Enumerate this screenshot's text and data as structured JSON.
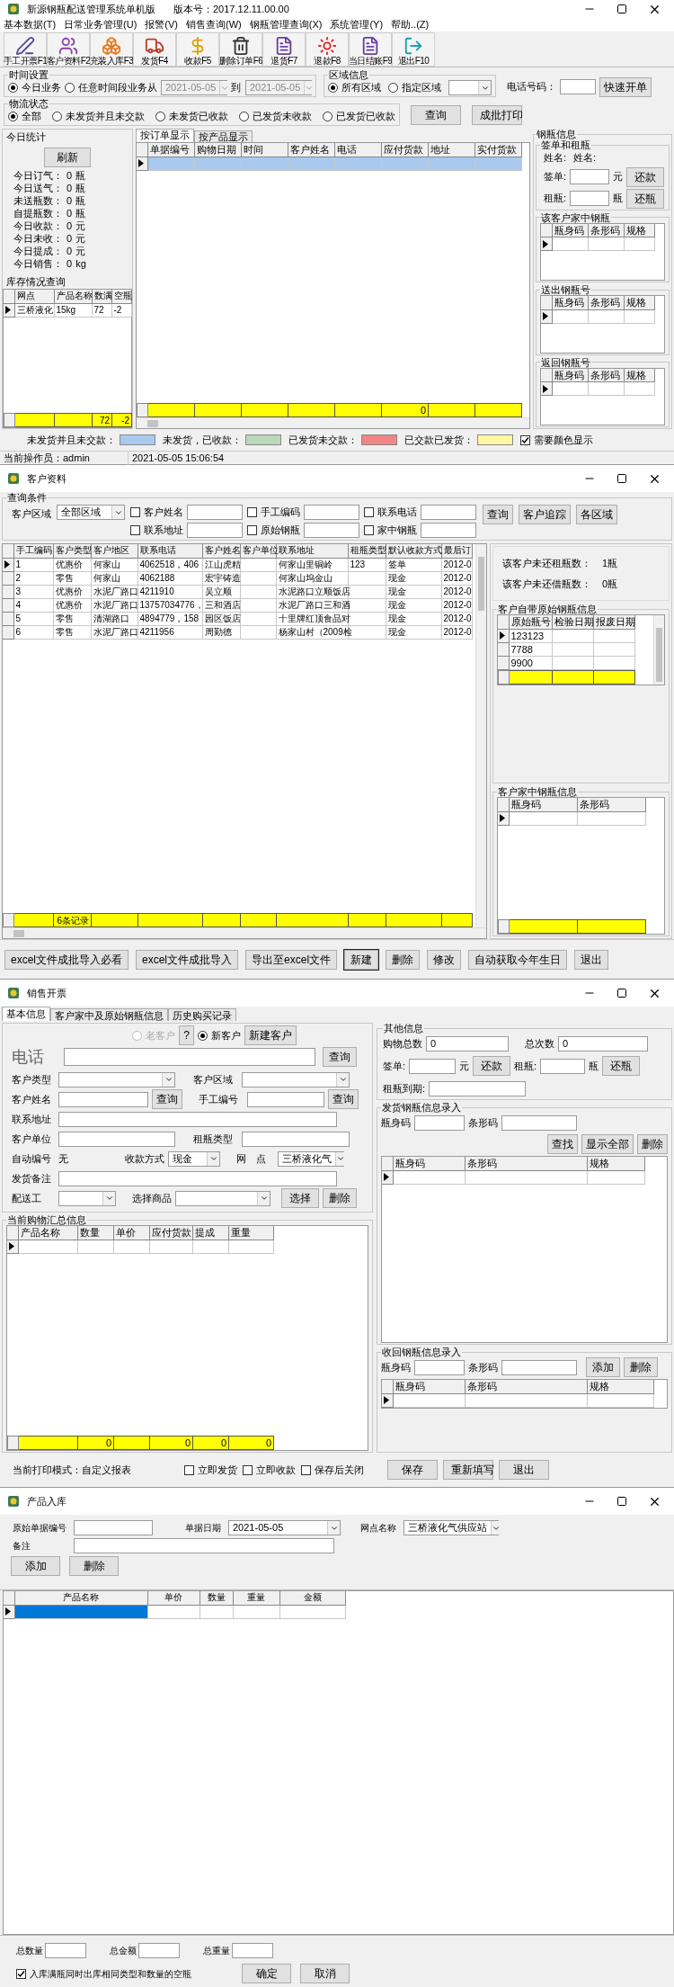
{
  "main_window": {
    "title": "新源钢瓶配送管理系统单机版",
    "version": "版本号：2017.12.11.00.00",
    "menu": [
      "基本数据(T)",
      "日常业务管理(U)",
      "报警(V)",
      "销售查询(W)",
      "钢瓶管理查询(X)",
      "系统管理(Y)",
      "帮助..(Z)"
    ],
    "toolbar": [
      "手工开票F1",
      "客户资料F2",
      "充装入库F3",
      "发货F4",
      "收款F5",
      "删除订单F6",
      "退货F7",
      "退款F8",
      "当日结账F9",
      "退出F10"
    ],
    "time_settings": {
      "title": "时间设置",
      "options": [
        {
          "label": "今日业务",
          "selected": true
        },
        {
          "label": "任意时间段业务从",
          "selected": false
        }
      ],
      "from": "2021-05-05",
      "to_label": "到",
      "to": "2021-05-05",
      "dates_disabled": true
    },
    "region": {
      "title": "区域信息",
      "options": [
        {
          "label": "所有区域",
          "selected": true
        },
        {
          "label": "指定区域",
          "selected": false
        }
      ]
    },
    "phone": {
      "label": "电话号码：",
      "button": "快速开单"
    },
    "logistics": {
      "title": "物流状态",
      "options": [
        {
          "label": "全部",
          "selected": true
        },
        {
          "label": "未发货并且未交款",
          "selected": false
        },
        {
          "label": "未发货已收款",
          "selected": false
        },
        {
          "label": "已发货未收款",
          "selected": false
        },
        {
          "label": "已发货已收款",
          "selected": false
        }
      ]
    },
    "actions": [
      "查询",
      "成批打印"
    ],
    "today_stats": {
      "title": "今日统计",
      "refresh": "刷新",
      "items": [
        {
          "label": "今日订气：",
          "value": "0",
          "unit": "瓶"
        },
        {
          "label": "今日送气：",
          "value": "0",
          "unit": "瓶"
        },
        {
          "label": "未送瓶数：",
          "value": "0",
          "unit": "瓶"
        },
        {
          "label": "自提瓶数：",
          "value": "0",
          "unit": "瓶"
        },
        {
          "label": "今日收款：",
          "value": "0",
          "unit": "元"
        },
        {
          "label": "今日未收：",
          "value": "0",
          "unit": "元"
        },
        {
          "label": "今日提成：",
          "value": "0",
          "unit": "元"
        },
        {
          "label": "今日销售：",
          "value": "0",
          "unit": "kg"
        }
      ]
    },
    "stock": {
      "title": "库存情况查询",
      "grid": {
        "columns": [
          {
            "label": "网点"
          },
          {
            "label": "产品名称"
          },
          {
            "label": "数满",
            "total": "72"
          },
          {
            "label": "空瓶",
            "total": "-2"
          }
        ],
        "footer_row": true,
        "rows": [
          {
            "cells": {
              "column_1": "三桥液化",
              "column_2": "15kg",
              "column_3": "72",
              "column_4": "-2"
            },
            "selected": true
          }
        ]
      }
    },
    "tabs": [
      {
        "label": "按订单显示",
        "selected": true
      },
      {
        "label": "按产品显示",
        "selected": false
      }
    ],
    "orders": {
      "columns": [
        {
          "label": "单据编号"
        },
        {
          "label": "购物日期"
        },
        {
          "label": "时间"
        },
        {
          "label": "客户姓名"
        },
        {
          "label": "电话"
        },
        {
          "label": "应付货款",
          "total": "0"
        },
        {
          "label": "地址"
        },
        {
          "label": "实付货款"
        }
      ],
      "footer_row": true,
      "empty_row": {
        "selected": true
      }
    },
    "cylinder_info": {
      "title": "钢瓶信息",
      "sign": {
        "title": "签单和租瓶",
        "name_label": "姓名:",
        "name_value": "姓名:",
        "sign_label": "签单:",
        "sign_unit": "元",
        "sign_button": "还款",
        "rent_label": "租瓶:",
        "rent_unit": "瓶",
        "rent_button": "还瓶"
      },
      "grids": [
        {
          "title": "该客户家中钢瓶",
          "columns": [
            {
              "label": "瓶身码"
            },
            {
              "label": "条形码"
            },
            {
              "label": "规格"
            }
          ],
          "empty_row": {
            "selected": false
          }
        },
        {
          "title": "送出钢瓶号",
          "columns": [
            {
              "label": "瓶身码"
            },
            {
              "label": "条形码"
            },
            {
              "label": "规格"
            }
          ],
          "empty_row": {
            "selected": false
          }
        },
        {
          "title": "返回钢瓶号",
          "columns": [
            {
              "label": "瓶身码"
            },
            {
              "label": "条形码"
            },
            {
              "label": "规格"
            }
          ],
          "empty_row": {
            "selected": false
          }
        }
      ]
    },
    "legend": [
      {
        "label": "未发货并且未交款：",
        "color": "#a9c9ef"
      },
      {
        "label": "未发货，已收款：",
        "color": "#b9d9b9"
      },
      {
        "label": "已发货未交款：",
        "color": "#f28585"
      },
      {
        "label": "已交款已发货：",
        "color": "#fff7a0"
      }
    ],
    "color_display": {
      "label": "需要颜色显示",
      "checked": true
    },
    "status_bar": [
      "当前操作员：admin",
      "2021-05-05 15:06:54"
    ]
  },
  "customer_window": {
    "title": "客户资料",
    "query_title": "查询条件",
    "region_label": "客户区域",
    "region_value": "全部区域",
    "filters": [
      {
        "label": "客户姓名",
        "checked": false
      },
      {
        "label": "手工编码",
        "checked": false
      },
      {
        "label": "联系电话",
        "checked": false
      },
      {
        "label": "联系地址",
        "checked": false
      },
      {
        "label": "原始钢瓶",
        "checked": false
      },
      {
        "label": "家中钢瓶",
        "checked": false
      }
    ],
    "buttons": [
      "查询",
      "客户追踪",
      "各区域"
    ],
    "grid": {
      "columns": [
        {
          "label": "手工编码"
        },
        {
          "label": "客户类型",
          "total": "6条记录"
        },
        {
          "label": "客户地区"
        },
        {
          "label": "联系电话"
        },
        {
          "label": "客户姓名"
        },
        {
          "label": "客户单位"
        },
        {
          "label": "联系地址"
        },
        {
          "label": "租瓶类型"
        },
        {
          "label": "默认收款方式"
        },
        {
          "label": "最后订"
        }
      ],
      "footer_row": true,
      "rows": [
        {
          "cells": {
            "column_1": "1",
            "column_2": "优惠价",
            "column_3": "何家山",
            "column_4": "4062518，406",
            "column_5": "江山虎精",
            "column_7": "何家山里铜岭",
            "column_8": "123",
            "column_9": "签单",
            "column_10": "2012-0"
          },
          "selected": true
        },
        {
          "cells": {
            "column_1": "2",
            "column_2": "零售",
            "column_3": "何家山",
            "column_4": "4062188",
            "column_5": "宏宇铸造",
            "column_7": "何家山坞金山",
            "column_9": "现金",
            "column_10": "2012-0"
          },
          "selected": false
        },
        {
          "cells": {
            "column_1": "3",
            "column_2": "优惠价",
            "column_3": "水泥厂路口",
            "column_4": "4211910",
            "column_5": "吴立顺",
            "column_7": "水泥路口立顺饭店",
            "column_9": "现金",
            "column_10": "2012-0"
          },
          "selected": false
        },
        {
          "cells": {
            "column_1": "4",
            "column_2": "优惠价",
            "column_3": "水泥厂路口",
            "column_4": "13757034776，",
            "column_5": "三和酒店",
            "column_7": "水泥厂路口三和酒",
            "column_9": "现金",
            "column_10": "2012-0"
          },
          "selected": false
        },
        {
          "cells": {
            "column_1": "5",
            "column_2": "零售",
            "column_3": "清湖路口",
            "column_4": "4894779，158",
            "column_5": "园区饭店",
            "column_7": "十里牌红顶食品对",
            "column_9": "现金",
            "column_10": "2012-0"
          },
          "selected": false
        },
        {
          "cells": {
            "column_1": "6",
            "column_2": "零售",
            "column_3": "水泥厂路口",
            "column_4": "4211956",
            "column_5": "周勤德",
            "column_7": "杨家山村（2009检",
            "column_9": "现金",
            "column_10": "2012-0"
          },
          "selected": false
        }
      ]
    },
    "unreturned": [
      {
        "label": "该客户未还租瓶数：",
        "value": "1瓶"
      },
      {
        "label": "该客户未还借瓶数：",
        "value": "0瓶"
      }
    ],
    "original_cylinders": {
      "title": "客户自带原始钢瓶信息",
      "columns": [
        {
          "label": "原始瓶号"
        },
        {
          "label": "检验日期"
        },
        {
          "label": "报废日期"
        }
      ],
      "footer_row": true,
      "rows": [
        {
          "cells": {
            "column_1": "123123"
          },
          "selected": true
        },
        {
          "cells": {
            "column_1": "7788"
          },
          "selected": false
        },
        {
          "cells": {
            "column_1": "9900"
          },
          "selected": false
        }
      ]
    },
    "home_cylinders": {
      "title": "客户家中钢瓶信息",
      "columns": [
        {
          "label": "瓶身码"
        },
        {
          "label": "条形码"
        }
      ],
      "empty_row": {
        "selected": false
      },
      "footer_row": true
    },
    "bottom_buttons": [
      {
        "label": "excel文件成批导入必看",
        "default": false
      },
      {
        "label": "excel文件成批导入",
        "default": false
      },
      {
        "label": "导出至excel文件",
        "default": false
      },
      {
        "label": "新建",
        "default": true
      },
      {
        "label": "删除",
        "default": false
      },
      {
        "label": "修改",
        "default": false
      },
      {
        "label": "自动获取今年生日",
        "default": false
      },
      {
        "label": "退出",
        "default": false
      }
    ]
  },
  "sales_window": {
    "title": "销售开票",
    "tabs": [
      {
        "label": "基本信息",
        "selected": true
      },
      {
        "label": "客户家中及原始钢瓶信息",
        "selected": false
      },
      {
        "label": "历史购买记录",
        "selected": false
      }
    ],
    "customer_mode": [
      {
        "label": "老客户",
        "selected": false,
        "disabled": true
      },
      {
        "label": "新客户",
        "selected": true,
        "disabled": false
      }
    ],
    "help_button": "?",
    "new_customer_button": "新建客户",
    "phone_label": "电话",
    "phone_query_button": "查询",
    "type_label": "客户类型",
    "area_label": "客户区域",
    "name_label": "客户姓名",
    "name_query_button": "查询",
    "code_label": "手工编号",
    "code_query_button": "查询",
    "address_label": "联系地址",
    "unit_label": "客户单位",
    "rent_type_label": "租瓶类型",
    "auto_no_label": "自动编号",
    "auto_no_value": "无",
    "payment_label": "收款方式",
    "payment_value": "现金",
    "outlet_label": "网　点",
    "outlet_value": "三桥液化气",
    "note_label": "发货备注",
    "courier_label": "配送工",
    "product_label": "选择商品",
    "select_button": "选择",
    "delete_button": "删除",
    "summary": {
      "title": "当前购物汇总信息",
      "columns": [
        {
          "label": "产品名称"
        },
        {
          "label": "数量",
          "total": "0"
        },
        {
          "label": "单价"
        },
        {
          "label": "应付货款",
          "total": "0"
        },
        {
          "label": "提成",
          "total": "0"
        },
        {
          "label": "重量",
          "total": "0"
        }
      ],
      "empty_row": {
        "selected": false
      },
      "footer_row": true
    },
    "other_info": {
      "title": "其他信息",
      "total_label": "购物总数",
      "total_value": "0",
      "count_label": "总次数",
      "count_value": "0",
      "sign_label": "签单:",
      "sign_unit": "元",
      "sign_button": "还款",
      "rent_label": "租瓶:",
      "rent_unit": "瓶",
      "rent_button": "还瓶",
      "due_label": "租瓶到期:"
    },
    "dispatch": {
      "title": "发货钢瓶信息录入",
      "body_label": "瓶身码",
      "barcode_label": "条形码",
      "buttons": [
        "查找",
        "显示全部",
        "删除"
      ],
      "columns": [
        {
          "label": "瓶身码"
        },
        {
          "label": "条形码"
        },
        {
          "label": "规格"
        }
      ],
      "empty_row": {
        "selected": false
      }
    },
    "recover": {
      "title": "收回钢瓶信息录入",
      "body_label": "瓶身码",
      "barcode_label": "条形码",
      "buttons": [
        "添加",
        "删除"
      ],
      "columns": [
        {
          "label": "瓶身码"
        },
        {
          "label": "条形码"
        },
        {
          "label": "规格"
        }
      ],
      "empty_row": {
        "selected": false
      }
    },
    "print_mode": "当前打印模式：自定义报表",
    "options": [
      {
        "label": "立即发货",
        "checked": false
      },
      {
        "label": "立即收款",
        "checked": false
      },
      {
        "label": "保存后关闭",
        "checked": false
      }
    ],
    "buttons": [
      "保存",
      "重新填写",
      "退出"
    ]
  },
  "stock_in_window": {
    "title": "产品入库",
    "doc_no_label": "原始单据编号",
    "date_label": "单据日期",
    "date_value": "2021-05-05",
    "outlet_label": "网点名称",
    "outlet_value": "三桥液化气供应站",
    "note_label": "备注",
    "buttons": [
      "添加",
      "删除"
    ],
    "grid": {
      "columns": [
        {
          "label": "产品名称"
        },
        {
          "label": "单价"
        },
        {
          "label": "数量"
        },
        {
          "label": "重量"
        },
        {
          "label": "金额"
        }
      ],
      "empty_row": {
        "selected": false,
        "first_cell_selected": true
      }
    },
    "totals": [
      "总数量",
      "总金额",
      "总重量"
    ],
    "same_out": {
      "label": "入库满瓶同时出库相同类型和数量的空瓶",
      "checked": true
    },
    "confirm_buttons": [
      "确定",
      "取消"
    ]
  }
}
